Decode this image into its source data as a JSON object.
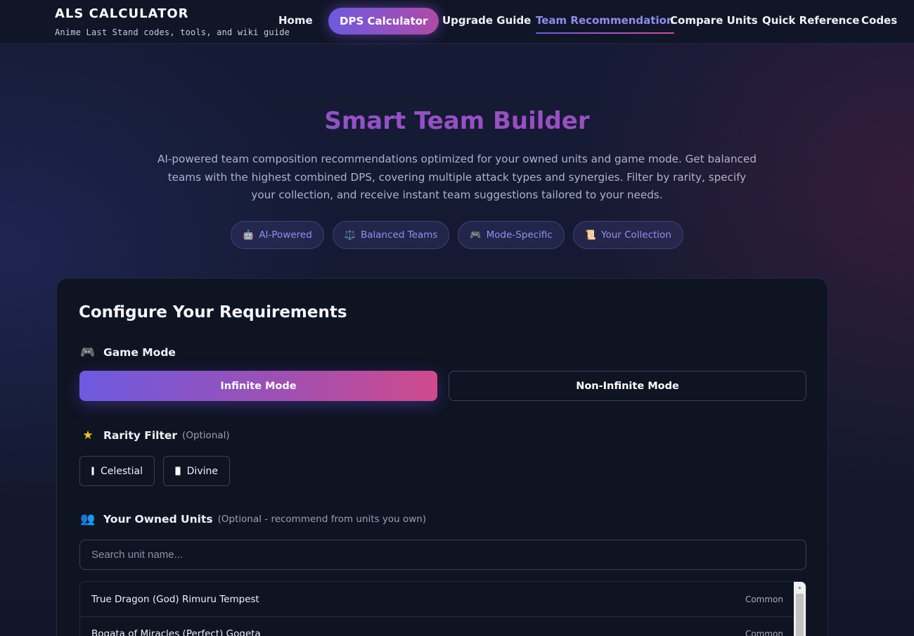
{
  "brand": {
    "title": "ALS CALCULATOR",
    "subtitle": "Anime Last Stand codes, tools, and wiki guide"
  },
  "nav": {
    "items": [
      {
        "label": "Home"
      },
      {
        "label": "DPS Calculator",
        "style": "pill"
      },
      {
        "label": "Upgrade Guide"
      },
      {
        "label": "Team Recommendation",
        "active": true
      },
      {
        "label": "Compare Units"
      },
      {
        "label": "Quick Reference"
      },
      {
        "label": "Codes"
      }
    ]
  },
  "hero": {
    "title": "Smart Team Builder",
    "description": "AI-powered team composition recommendations optimized for your owned units and game mode. Get balanced teams with the highest combined DPS, covering multiple attack types and synergies. Filter by rarity, specify your collection, and receive instant team suggestions tailored to your needs.",
    "badges": [
      {
        "icon": "robot-icon",
        "label": "AI-Powered"
      },
      {
        "icon": "balance-scale-icon",
        "label": "Balanced Teams"
      },
      {
        "icon": "gamepad-icon",
        "label": "Mode-Specific"
      },
      {
        "icon": "scroll-icon",
        "label": "Your Collection"
      }
    ]
  },
  "config": {
    "title": "Configure Your Requirements",
    "game_mode": {
      "label": "Game Mode",
      "icon": "gamepad-icon",
      "options": [
        {
          "label": "Infinite Mode",
          "selected": true
        },
        {
          "label": "Non-Infinite Mode",
          "selected": false
        }
      ]
    },
    "rarity": {
      "label": "Rarity Filter",
      "icon": "star-icon",
      "optional": "(Optional)",
      "options": [
        {
          "label": "Celestial",
          "checked": false
        },
        {
          "label": "Divine",
          "checked": false
        }
      ]
    },
    "owned": {
      "label": "Your Owned Units",
      "icon": "users-icon",
      "optional": "(Optional - recommend from units you own)",
      "search_placeholder": "Search unit name...",
      "units": [
        {
          "name": "True Dragon (God) Rimuru Tempest",
          "rarity": "Common"
        },
        {
          "name": "Bogata of Miracles (Perfect) Gogeta",
          "rarity": "Common"
        }
      ]
    }
  },
  "colors": {
    "accent_purple": "#6d5ae0",
    "accent_pink": "#d14a8c",
    "bg": "#141a30",
    "card": "#0f1423"
  }
}
